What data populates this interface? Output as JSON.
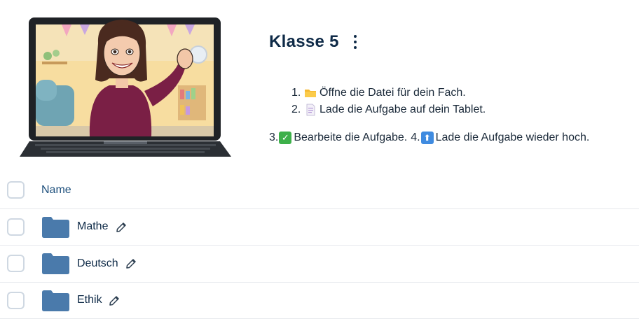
{
  "header": {
    "title": "Klasse 5",
    "menu_icon": "kebab-menu-icon"
  },
  "instructions": {
    "steps": [
      {
        "number": "1.",
        "icon": "folder-emoji",
        "text": "Öffne die Datei für dein Fach."
      },
      {
        "number": "2.",
        "icon": "page-emoji",
        "text": "Lade die Aufgabe auf dein Tablet."
      }
    ],
    "inline_steps": [
      {
        "number": "3.",
        "icon": "check-mark-emoji",
        "text": "Bearbeite die Aufgabe."
      },
      {
        "number": "4.",
        "icon": "up-arrow-emoji",
        "text": "Lade die Aufgabe wieder hoch."
      }
    ]
  },
  "table": {
    "column_name": "Name",
    "rows": [
      {
        "name": "Mathe",
        "icon": "folder-icon",
        "action_icon": "edit-pencil-icon"
      },
      {
        "name": "Deutsch",
        "icon": "folder-icon",
        "action_icon": "edit-pencil-icon"
      },
      {
        "name": "Ethik",
        "icon": "folder-icon",
        "action_icon": "edit-pencil-icon"
      }
    ]
  },
  "colors": {
    "title": "#0e2a47",
    "folder": "#4a7aab",
    "header_text": "#1d4f7c",
    "checkbox_border": "#cfd8e2"
  }
}
